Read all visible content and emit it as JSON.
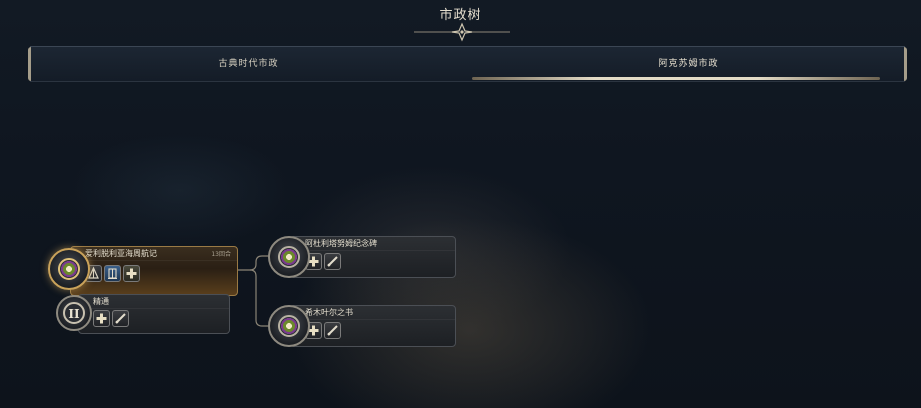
{
  "header": {
    "title": "市政树"
  },
  "tabs": [
    {
      "label": "古典时代市政",
      "selected": false
    },
    {
      "label": "阿克苏姆市政",
      "selected": true
    }
  ],
  "nodes": {
    "adulis": {
      "name": "爱利脱利亚海周航记",
      "turns": "13回合",
      "status": "researching",
      "icons": [
        "wonder-icon",
        "building-icon",
        "plus-icon"
      ]
    },
    "mastery": {
      "name": "精通",
      "numeral": "II",
      "icons": [
        "plus-icon",
        "sword-icon"
      ]
    },
    "monument": {
      "name": "阿杜利塔努姆纪念碑",
      "icons": [
        "plus-icon",
        "sword-icon"
      ]
    },
    "book": {
      "name": "希木叶尔之书",
      "icons": [
        "plus-icon",
        "sword-icon"
      ]
    }
  },
  "colors": {
    "accent_gold": "#c9a25a",
    "tab_underline": "#e3dbc6",
    "background": "#0f1620"
  }
}
